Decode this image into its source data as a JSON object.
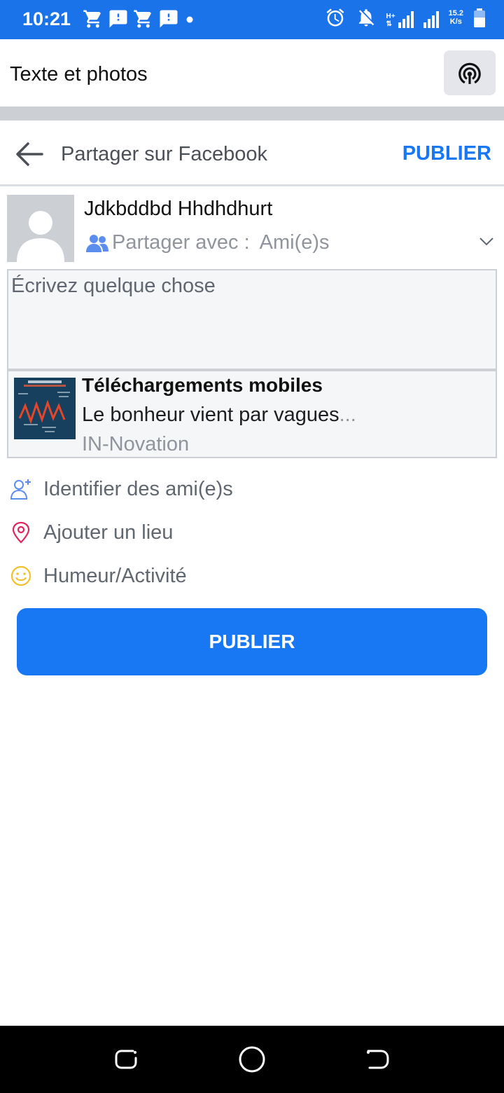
{
  "status_bar": {
    "time": "10:21",
    "left_icons": [
      "cart-icon",
      "message-alert-icon",
      "cart-icon",
      "message-alert-icon",
      "dot-icon"
    ],
    "right_icons": [
      "alarm-icon",
      "notifications-off-icon",
      "signal-hplus-icon",
      "signal-icon",
      "battery-icon"
    ],
    "network_type": "H+",
    "net_speed_value": "15.2",
    "net_speed_unit": "K/s"
  },
  "appbar": {
    "title": "Texte et photos"
  },
  "share_header": {
    "title": "Partager sur Facebook",
    "publish_label": "PUBLIER"
  },
  "user": {
    "name": "Jdkbddbd Hhdhdhurt",
    "share_with_label": "Partager avec :",
    "audience": "Ami(e)s"
  },
  "composer": {
    "placeholder": "Écrivez quelque chose"
  },
  "link_card": {
    "title": "Téléchargements mobiles",
    "description": "Le bonheur vient par vagues",
    "ellipsis": "...",
    "source": "IN-Novation"
  },
  "options": [
    {
      "label": "Identifier des ami(e)s",
      "icon": "tag-friends-icon"
    },
    {
      "label": "Ajouter un lieu",
      "icon": "location-pin-icon"
    },
    {
      "label": "Humeur/Activité",
      "icon": "smiley-icon"
    }
  ],
  "publish_button": {
    "label": "PUBLIER"
  },
  "colors": {
    "status_bar": "#1a73e8",
    "accent": "#1877f2",
    "secondary_text": "#90949c",
    "location_icon": "#e0245e",
    "smiley_icon": "#f2c12e"
  }
}
